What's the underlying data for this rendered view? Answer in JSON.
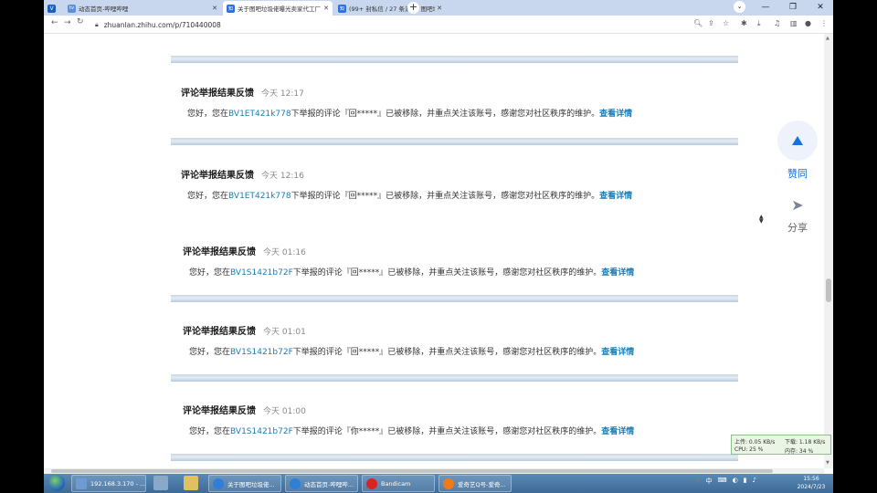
{
  "tabs": [
    {
      "icon": "bilibili",
      "title": "动态首页-哔哩哔哩",
      "active": false
    },
    {
      "icon": "zhihu",
      "title": "关于图吧垃圾佬曝光卖家代工厂",
      "active": true
    },
    {
      "icon": "zhihu",
      "title": "(99+ 封私信 / 27 条消息) 图吧垃",
      "active": false
    }
  ],
  "url": "zhuanlan.zhihu.com/p/710440008",
  "cards": [
    {
      "title": "评论举报结果反馈",
      "time": "今天 12:17",
      "greeting": "您好，您在",
      "bv": "BV1ET421k778",
      "body_after": "下举报的评论『回*****』已被移除，并重点关注该账号，感谢您对社区秩序的维护。",
      "detail": "查看详情"
    },
    {
      "title": "评论举报结果反馈",
      "time": "今天 12:16",
      "greeting": "您好，您在",
      "bv": "BV1ET421k778",
      "body_after": "下举报的评论『回*****』已被移除，并重点关注该账号，感谢您对社区秩序的维护。",
      "detail": "查看详情"
    },
    {
      "title": "评论举报结果反馈",
      "time": "今天 01:16",
      "greeting": "您好，您在",
      "bv": "BV1S1421b72F",
      "body_after": "下举报的评论『回*****』已被移除，并重点关注该账号，感谢您对社区秩序的维护。",
      "detail": "查看详情"
    },
    {
      "title": "评论举报结果反馈",
      "time": "今天 01:01",
      "greeting": "您好，您在",
      "bv": "BV1S1421b72F",
      "body_after": "下举报的评论『回*****』已被移除，并重点关注该账号，感谢您对社区秩序的维护。",
      "detail": "查看详情"
    },
    {
      "title": "评论举报结果反馈",
      "time": "今天 01:00",
      "greeting": "您好，您在",
      "bv": "BV1S1421b72F",
      "body_after": "下举报的评论『你*****』已被移除，并重点关注该账号，感谢您对社区秩序的维护。",
      "detail": "查看详情"
    }
  ],
  "side": {
    "like_label": "赞同",
    "share_label": "分享"
  },
  "netmon": {
    "up": "上传: 0.05 KB/s",
    "down": "下载: 1.18 KB/s",
    "cpu": "CPU: 25 %",
    "mem": "内存: 34 %"
  },
  "taskbar": {
    "items": [
      {
        "label": "192.168.3.170 - ...",
        "color": "#6e9bd1"
      },
      {
        "label": "关于图吧垃圾佬...",
        "color": "#2f7fd8"
      },
      {
        "label": "动态首页-哔哩哔...",
        "color": "#2f7fd8"
      },
      {
        "label": "Bandicam",
        "color": "#d22"
      },
      {
        "label": "爱奇艺Q号-爱奇...",
        "color": "#f07a1a"
      }
    ],
    "time": "15:56",
    "date": "2024/7/23"
  },
  "colors": {
    "accent": "#1a6fe0",
    "link": "#1a7db3"
  }
}
